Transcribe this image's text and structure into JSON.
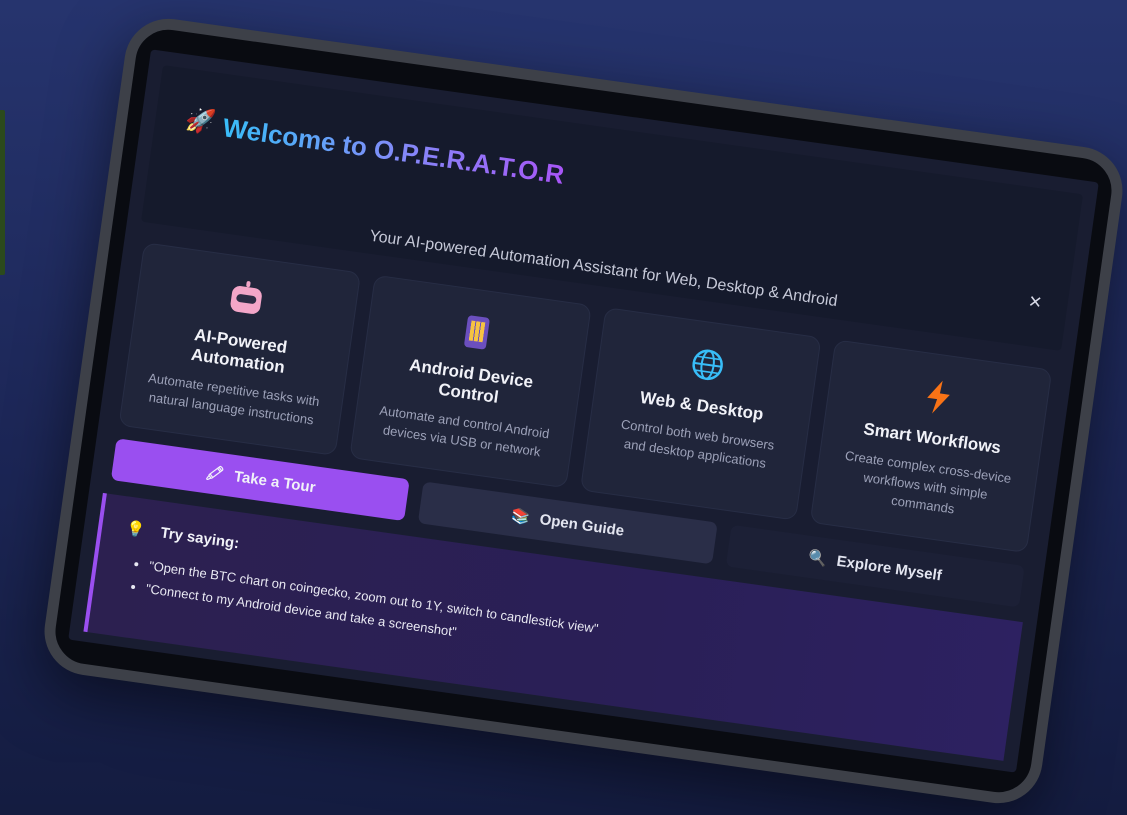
{
  "header": {
    "title": "Welcome to O.P.E.R.A.T.O.R",
    "close_label": "×",
    "subtitle": "Your AI-powered Automation Assistant for Web, Desktop & Android"
  },
  "features": [
    {
      "icon": "robot-icon",
      "title": "AI-Powered Automation",
      "description": "Automate repetitive tasks with natural language instructions"
    },
    {
      "icon": "phone-icon",
      "title": "Android Device Control",
      "description": "Automate and control Android devices via USB or network"
    },
    {
      "icon": "globe-icon",
      "title": "Web & Desktop",
      "description": "Control both web browsers and desktop applications"
    },
    {
      "icon": "lightning-icon",
      "title": "Smart Workflows",
      "description": "Create complex cross-device workflows with simple commands"
    }
  ],
  "actions": {
    "tour_label": "Take a Tour",
    "guide_label": "Open Guide",
    "explore_label": "Explore Myself"
  },
  "tip": {
    "heading": "Try saying:",
    "examples": [
      "\"Open the BTC chart on coingecko, zoom out to 1Y, switch to candlestick view\"",
      "\"Connect to my Android device and take a screenshot\""
    ]
  },
  "colors": {
    "accent": "#9a4ff0",
    "title_gradient_start": "#38bdf8",
    "title_gradient_end": "#a855f7",
    "background": "#1c2656"
  }
}
